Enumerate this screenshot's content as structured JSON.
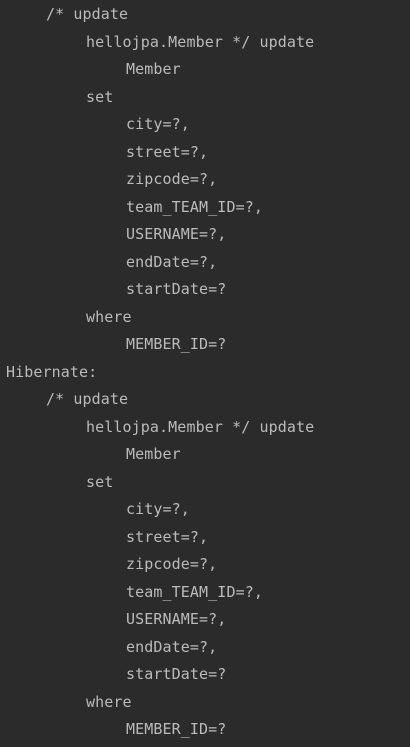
{
  "console": {
    "lines": [
      {
        "text": "/* update",
        "indent": 1
      },
      {
        "text": "hellojpa.Member */ update",
        "indent": 2
      },
      {
        "text": "Member",
        "indent": 3
      },
      {
        "text": "set",
        "indent": 2
      },
      {
        "text": "city=?,",
        "indent": 3
      },
      {
        "text": "street=?,",
        "indent": 3
      },
      {
        "text": "zipcode=?,",
        "indent": 3
      },
      {
        "text": "team_TEAM_ID=?,",
        "indent": 3
      },
      {
        "text": "USERNAME=?,",
        "indent": 3
      },
      {
        "text": "endDate=?,",
        "indent": 3
      },
      {
        "text": "startDate=?",
        "indent": 3
      },
      {
        "text": "where",
        "indent": 2
      },
      {
        "text": "MEMBER_ID=?",
        "indent": 3
      },
      {
        "text": "Hibernate:",
        "indent": 0
      },
      {
        "text": "/* update",
        "indent": 1
      },
      {
        "text": "hellojpa.Member */ update",
        "indent": 2
      },
      {
        "text": "Member",
        "indent": 3
      },
      {
        "text": "set",
        "indent": 2
      },
      {
        "text": "city=?,",
        "indent": 3
      },
      {
        "text": "street=?,",
        "indent": 3
      },
      {
        "text": "zipcode=?,",
        "indent": 3
      },
      {
        "text": "team_TEAM_ID=?,",
        "indent": 3
      },
      {
        "text": "USERNAME=?,",
        "indent": 3
      },
      {
        "text": "endDate=?,",
        "indent": 3
      },
      {
        "text": "startDate=?",
        "indent": 3
      },
      {
        "text": "where",
        "indent": 2
      },
      {
        "text": "MEMBER_ID=?",
        "indent": 3
      }
    ]
  },
  "colors": {
    "background": "#2b2b2b",
    "text": "#bbbbbb"
  }
}
